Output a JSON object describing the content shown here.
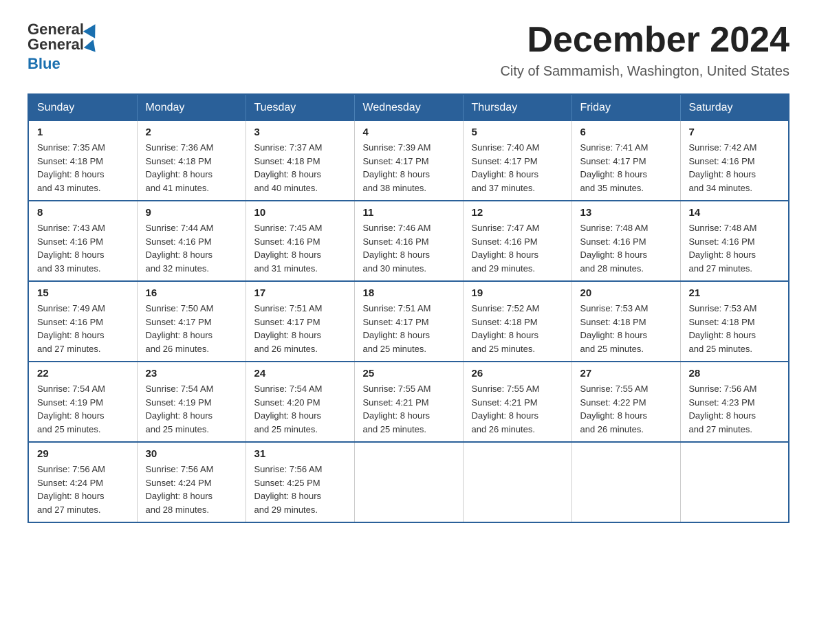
{
  "header": {
    "logo_general": "General",
    "logo_blue": "Blue",
    "main_title": "December 2024",
    "subtitle": "City of Sammamish, Washington, United States"
  },
  "days_of_week": [
    "Sunday",
    "Monday",
    "Tuesday",
    "Wednesday",
    "Thursday",
    "Friday",
    "Saturday"
  ],
  "weeks": [
    [
      {
        "day": "1",
        "sunrise": "7:35 AM",
        "sunset": "4:18 PM",
        "daylight": "8 hours and 43 minutes."
      },
      {
        "day": "2",
        "sunrise": "7:36 AM",
        "sunset": "4:18 PM",
        "daylight": "8 hours and 41 minutes."
      },
      {
        "day": "3",
        "sunrise": "7:37 AM",
        "sunset": "4:18 PM",
        "daylight": "8 hours and 40 minutes."
      },
      {
        "day": "4",
        "sunrise": "7:39 AM",
        "sunset": "4:17 PM",
        "daylight": "8 hours and 38 minutes."
      },
      {
        "day": "5",
        "sunrise": "7:40 AM",
        "sunset": "4:17 PM",
        "daylight": "8 hours and 37 minutes."
      },
      {
        "day": "6",
        "sunrise": "7:41 AM",
        "sunset": "4:17 PM",
        "daylight": "8 hours and 35 minutes."
      },
      {
        "day": "7",
        "sunrise": "7:42 AM",
        "sunset": "4:16 PM",
        "daylight": "8 hours and 34 minutes."
      }
    ],
    [
      {
        "day": "8",
        "sunrise": "7:43 AM",
        "sunset": "4:16 PM",
        "daylight": "8 hours and 33 minutes."
      },
      {
        "day": "9",
        "sunrise": "7:44 AM",
        "sunset": "4:16 PM",
        "daylight": "8 hours and 32 minutes."
      },
      {
        "day": "10",
        "sunrise": "7:45 AM",
        "sunset": "4:16 PM",
        "daylight": "8 hours and 31 minutes."
      },
      {
        "day": "11",
        "sunrise": "7:46 AM",
        "sunset": "4:16 PM",
        "daylight": "8 hours and 30 minutes."
      },
      {
        "day": "12",
        "sunrise": "7:47 AM",
        "sunset": "4:16 PM",
        "daylight": "8 hours and 29 minutes."
      },
      {
        "day": "13",
        "sunrise": "7:48 AM",
        "sunset": "4:16 PM",
        "daylight": "8 hours and 28 minutes."
      },
      {
        "day": "14",
        "sunrise": "7:48 AM",
        "sunset": "4:16 PM",
        "daylight": "8 hours and 27 minutes."
      }
    ],
    [
      {
        "day": "15",
        "sunrise": "7:49 AM",
        "sunset": "4:16 PM",
        "daylight": "8 hours and 27 minutes."
      },
      {
        "day": "16",
        "sunrise": "7:50 AM",
        "sunset": "4:17 PM",
        "daylight": "8 hours and 26 minutes."
      },
      {
        "day": "17",
        "sunrise": "7:51 AM",
        "sunset": "4:17 PM",
        "daylight": "8 hours and 26 minutes."
      },
      {
        "day": "18",
        "sunrise": "7:51 AM",
        "sunset": "4:17 PM",
        "daylight": "8 hours and 25 minutes."
      },
      {
        "day": "19",
        "sunrise": "7:52 AM",
        "sunset": "4:18 PM",
        "daylight": "8 hours and 25 minutes."
      },
      {
        "day": "20",
        "sunrise": "7:53 AM",
        "sunset": "4:18 PM",
        "daylight": "8 hours and 25 minutes."
      },
      {
        "day": "21",
        "sunrise": "7:53 AM",
        "sunset": "4:18 PM",
        "daylight": "8 hours and 25 minutes."
      }
    ],
    [
      {
        "day": "22",
        "sunrise": "7:54 AM",
        "sunset": "4:19 PM",
        "daylight": "8 hours and 25 minutes."
      },
      {
        "day": "23",
        "sunrise": "7:54 AM",
        "sunset": "4:19 PM",
        "daylight": "8 hours and 25 minutes."
      },
      {
        "day": "24",
        "sunrise": "7:54 AM",
        "sunset": "4:20 PM",
        "daylight": "8 hours and 25 minutes."
      },
      {
        "day": "25",
        "sunrise": "7:55 AM",
        "sunset": "4:21 PM",
        "daylight": "8 hours and 25 minutes."
      },
      {
        "day": "26",
        "sunrise": "7:55 AM",
        "sunset": "4:21 PM",
        "daylight": "8 hours and 26 minutes."
      },
      {
        "day": "27",
        "sunrise": "7:55 AM",
        "sunset": "4:22 PM",
        "daylight": "8 hours and 26 minutes."
      },
      {
        "day": "28",
        "sunrise": "7:56 AM",
        "sunset": "4:23 PM",
        "daylight": "8 hours and 27 minutes."
      }
    ],
    [
      {
        "day": "29",
        "sunrise": "7:56 AM",
        "sunset": "4:24 PM",
        "daylight": "8 hours and 27 minutes."
      },
      {
        "day": "30",
        "sunrise": "7:56 AM",
        "sunset": "4:24 PM",
        "daylight": "8 hours and 28 minutes."
      },
      {
        "day": "31",
        "sunrise": "7:56 AM",
        "sunset": "4:25 PM",
        "daylight": "8 hours and 29 minutes."
      },
      null,
      null,
      null,
      null
    ]
  ],
  "labels": {
    "sunrise_prefix": "Sunrise: ",
    "sunset_prefix": "Sunset: ",
    "daylight_prefix": "Daylight: "
  }
}
